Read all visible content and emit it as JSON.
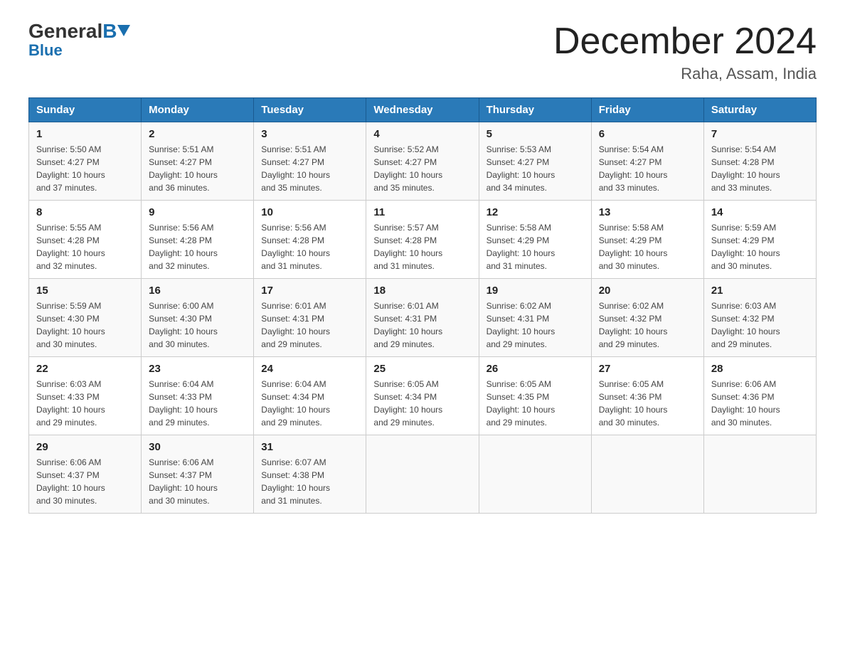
{
  "logo": {
    "general": "General",
    "blue": "Blue",
    "arrow": "▼"
  },
  "header": {
    "month_year": "December 2024",
    "location": "Raha, Assam, India"
  },
  "columns": [
    "Sunday",
    "Monday",
    "Tuesday",
    "Wednesday",
    "Thursday",
    "Friday",
    "Saturday"
  ],
  "weeks": [
    [
      {
        "day": "1",
        "sunrise": "5:50 AM",
        "sunset": "4:27 PM",
        "daylight": "10 hours and 37 minutes."
      },
      {
        "day": "2",
        "sunrise": "5:51 AM",
        "sunset": "4:27 PM",
        "daylight": "10 hours and 36 minutes."
      },
      {
        "day": "3",
        "sunrise": "5:51 AM",
        "sunset": "4:27 PM",
        "daylight": "10 hours and 35 minutes."
      },
      {
        "day": "4",
        "sunrise": "5:52 AM",
        "sunset": "4:27 PM",
        "daylight": "10 hours and 35 minutes."
      },
      {
        "day": "5",
        "sunrise": "5:53 AM",
        "sunset": "4:27 PM",
        "daylight": "10 hours and 34 minutes."
      },
      {
        "day": "6",
        "sunrise": "5:54 AM",
        "sunset": "4:27 PM",
        "daylight": "10 hours and 33 minutes."
      },
      {
        "day": "7",
        "sunrise": "5:54 AM",
        "sunset": "4:28 PM",
        "daylight": "10 hours and 33 minutes."
      }
    ],
    [
      {
        "day": "8",
        "sunrise": "5:55 AM",
        "sunset": "4:28 PM",
        "daylight": "10 hours and 32 minutes."
      },
      {
        "day": "9",
        "sunrise": "5:56 AM",
        "sunset": "4:28 PM",
        "daylight": "10 hours and 32 minutes."
      },
      {
        "day": "10",
        "sunrise": "5:56 AM",
        "sunset": "4:28 PM",
        "daylight": "10 hours and 31 minutes."
      },
      {
        "day": "11",
        "sunrise": "5:57 AM",
        "sunset": "4:28 PM",
        "daylight": "10 hours and 31 minutes."
      },
      {
        "day": "12",
        "sunrise": "5:58 AM",
        "sunset": "4:29 PM",
        "daylight": "10 hours and 31 minutes."
      },
      {
        "day": "13",
        "sunrise": "5:58 AM",
        "sunset": "4:29 PM",
        "daylight": "10 hours and 30 minutes."
      },
      {
        "day": "14",
        "sunrise": "5:59 AM",
        "sunset": "4:29 PM",
        "daylight": "10 hours and 30 minutes."
      }
    ],
    [
      {
        "day": "15",
        "sunrise": "5:59 AM",
        "sunset": "4:30 PM",
        "daylight": "10 hours and 30 minutes."
      },
      {
        "day": "16",
        "sunrise": "6:00 AM",
        "sunset": "4:30 PM",
        "daylight": "10 hours and 30 minutes."
      },
      {
        "day": "17",
        "sunrise": "6:01 AM",
        "sunset": "4:31 PM",
        "daylight": "10 hours and 29 minutes."
      },
      {
        "day": "18",
        "sunrise": "6:01 AM",
        "sunset": "4:31 PM",
        "daylight": "10 hours and 29 minutes."
      },
      {
        "day": "19",
        "sunrise": "6:02 AM",
        "sunset": "4:31 PM",
        "daylight": "10 hours and 29 minutes."
      },
      {
        "day": "20",
        "sunrise": "6:02 AM",
        "sunset": "4:32 PM",
        "daylight": "10 hours and 29 minutes."
      },
      {
        "day": "21",
        "sunrise": "6:03 AM",
        "sunset": "4:32 PM",
        "daylight": "10 hours and 29 minutes."
      }
    ],
    [
      {
        "day": "22",
        "sunrise": "6:03 AM",
        "sunset": "4:33 PM",
        "daylight": "10 hours and 29 minutes."
      },
      {
        "day": "23",
        "sunrise": "6:04 AM",
        "sunset": "4:33 PM",
        "daylight": "10 hours and 29 minutes."
      },
      {
        "day": "24",
        "sunrise": "6:04 AM",
        "sunset": "4:34 PM",
        "daylight": "10 hours and 29 minutes."
      },
      {
        "day": "25",
        "sunrise": "6:05 AM",
        "sunset": "4:34 PM",
        "daylight": "10 hours and 29 minutes."
      },
      {
        "day": "26",
        "sunrise": "6:05 AM",
        "sunset": "4:35 PM",
        "daylight": "10 hours and 29 minutes."
      },
      {
        "day": "27",
        "sunrise": "6:05 AM",
        "sunset": "4:36 PM",
        "daylight": "10 hours and 30 minutes."
      },
      {
        "day": "28",
        "sunrise": "6:06 AM",
        "sunset": "4:36 PM",
        "daylight": "10 hours and 30 minutes."
      }
    ],
    [
      {
        "day": "29",
        "sunrise": "6:06 AM",
        "sunset": "4:37 PM",
        "daylight": "10 hours and 30 minutes."
      },
      {
        "day": "30",
        "sunrise": "6:06 AM",
        "sunset": "4:37 PM",
        "daylight": "10 hours and 30 minutes."
      },
      {
        "day": "31",
        "sunrise": "6:07 AM",
        "sunset": "4:38 PM",
        "daylight": "10 hours and 31 minutes."
      },
      null,
      null,
      null,
      null
    ]
  ],
  "labels": {
    "sunrise": "Sunrise:",
    "sunset": "Sunset:",
    "daylight": "Daylight:"
  }
}
